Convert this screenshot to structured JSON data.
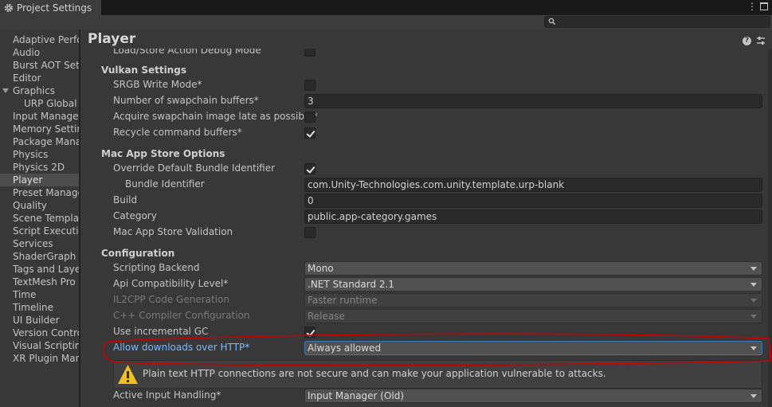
{
  "window": {
    "tab_title": "Project Settings"
  },
  "search": {
    "placeholder": ""
  },
  "sidebar": {
    "items": [
      {
        "label": "Adaptive Performance",
        "level": 0
      },
      {
        "label": "Audio",
        "level": 0
      },
      {
        "label": "Burst AOT Settings",
        "level": 0
      },
      {
        "label": "Editor",
        "level": 0
      },
      {
        "label": "Graphics",
        "level": 0,
        "expanded": true
      },
      {
        "label": "URP Global Settings",
        "level": 1
      },
      {
        "label": "Input Manager",
        "level": 0
      },
      {
        "label": "Memory Settings",
        "level": 0
      },
      {
        "label": "Package Manager",
        "level": 0
      },
      {
        "label": "Physics",
        "level": 0
      },
      {
        "label": "Physics 2D",
        "level": 0
      },
      {
        "label": "Player",
        "level": 0,
        "selected": true
      },
      {
        "label": "Preset Manager",
        "level": 0
      },
      {
        "label": "Quality",
        "level": 0
      },
      {
        "label": "Scene Template",
        "level": 0
      },
      {
        "label": "Script Execution Order",
        "level": 0
      },
      {
        "label": "Services",
        "level": 0
      },
      {
        "label": "ShaderGraph",
        "level": 0
      },
      {
        "label": "Tags and Layers",
        "level": 0
      },
      {
        "label": "TextMesh Pro",
        "level": 0
      },
      {
        "label": "Time",
        "level": 0
      },
      {
        "label": "Timeline",
        "level": 0
      },
      {
        "label": "UI Builder",
        "level": 0
      },
      {
        "label": "Version Control",
        "level": 0
      },
      {
        "label": "Visual Scripting",
        "level": 0
      },
      {
        "label": "XR Plugin Management",
        "level": 0
      }
    ]
  },
  "main": {
    "title": "Player",
    "rows": [
      {
        "kind": "field",
        "label": "Load/Store Action Debug Mode",
        "control": "checkbox",
        "checked": false
      },
      {
        "kind": "section",
        "label": "Vulkan Settings"
      },
      {
        "kind": "field",
        "label": "SRGB Write Mode*",
        "control": "checkbox",
        "checked": false
      },
      {
        "kind": "field",
        "label": "Number of swapchain buffers*",
        "control": "text",
        "value": "3"
      },
      {
        "kind": "field",
        "label": "Acquire swapchain image late as possible*",
        "control": "checkbox",
        "checked": false
      },
      {
        "kind": "field",
        "label": "Recycle command buffers*",
        "control": "checkbox",
        "checked": true
      },
      {
        "kind": "section",
        "label": "Mac App Store Options"
      },
      {
        "kind": "field",
        "label": "Override Default Bundle Identifier",
        "control": "checkbox",
        "checked": true
      },
      {
        "kind": "field",
        "label": "Bundle Identifier",
        "control": "text",
        "value": "com.Unity-Technologies.com.unity.template.urp-blank",
        "indent": true
      },
      {
        "kind": "field",
        "label": "Build",
        "control": "text",
        "value": "0"
      },
      {
        "kind": "field",
        "label": "Category",
        "control": "text",
        "value": "public.app-category.games"
      },
      {
        "kind": "field",
        "label": "Mac App Store Validation",
        "control": "checkbox",
        "checked": false
      },
      {
        "kind": "section",
        "label": "Configuration"
      },
      {
        "kind": "field",
        "label": "Scripting Backend",
        "control": "dropdown",
        "value": "Mono"
      },
      {
        "kind": "field",
        "label": "Api Compatibility Level*",
        "control": "dropdown",
        "value": ".NET Standard 2.1"
      },
      {
        "kind": "field",
        "label": "IL2CPP Code Generation",
        "control": "dropdown",
        "value": "Faster runtime",
        "disabled": true
      },
      {
        "kind": "field",
        "label": "C++ Compiler Configuration",
        "control": "dropdown",
        "value": "Release",
        "disabled": true
      },
      {
        "kind": "field",
        "label": "Use incremental GC",
        "control": "checkbox",
        "checked": true
      },
      {
        "kind": "field",
        "label": "Allow downloads over HTTP*",
        "control": "dropdown",
        "value": "Always allowed",
        "highlight": true
      },
      {
        "kind": "warning",
        "label": "Plain text HTTP connections are not secure and can make your application vulnerable to attacks."
      },
      {
        "kind": "field",
        "label": "Active Input Handling*",
        "control": "dropdown",
        "value": "Input Manager (Old)"
      }
    ]
  },
  "colors": {
    "annotation": "#cc0000",
    "warning": "#f0c020",
    "highlight_label": "#7cb8ff"
  },
  "icons": [
    "gear-icon",
    "kebab-menu-icon",
    "maximize-icon",
    "search-icon",
    "help-icon",
    "preset-icon",
    "warning-icon",
    "expand-arrow-icon",
    "dropdown-arrow-icon",
    "checkmark-icon"
  ]
}
